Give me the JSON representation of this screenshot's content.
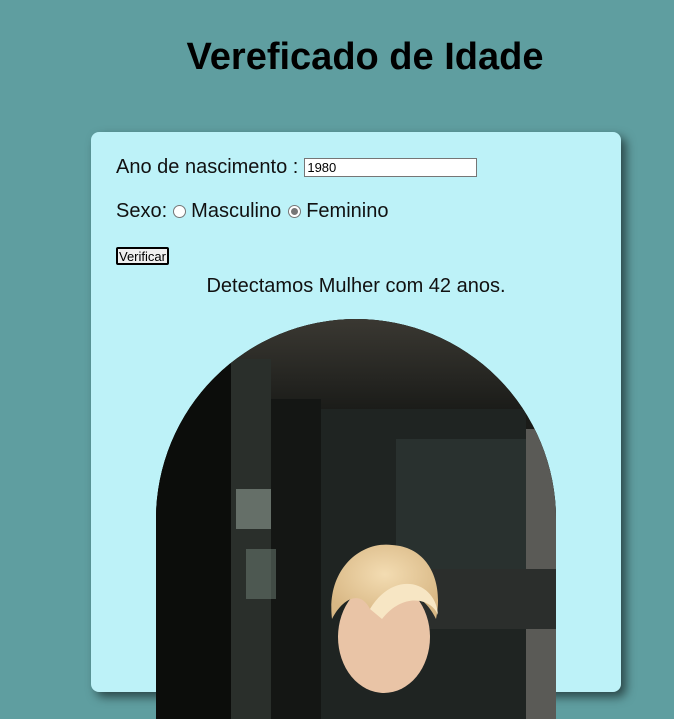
{
  "page": {
    "title": "Vereficado de Idade"
  },
  "form": {
    "year_label": "Ano de nascimento :",
    "year_value": "1980",
    "sex_label": "Sexo:",
    "sex_options": [
      {
        "label": "Masculino",
        "checked": false
      },
      {
        "label": "Feminino",
        "checked": true
      }
    ],
    "submit_label": "Verificar"
  },
  "result": {
    "text": "Detectamos Mulher com 42 anos."
  },
  "colors": {
    "page_background": "#5f9ea0",
    "panel_background": "#bdf2f8"
  },
  "image": {
    "icon": "portrait-photo"
  }
}
